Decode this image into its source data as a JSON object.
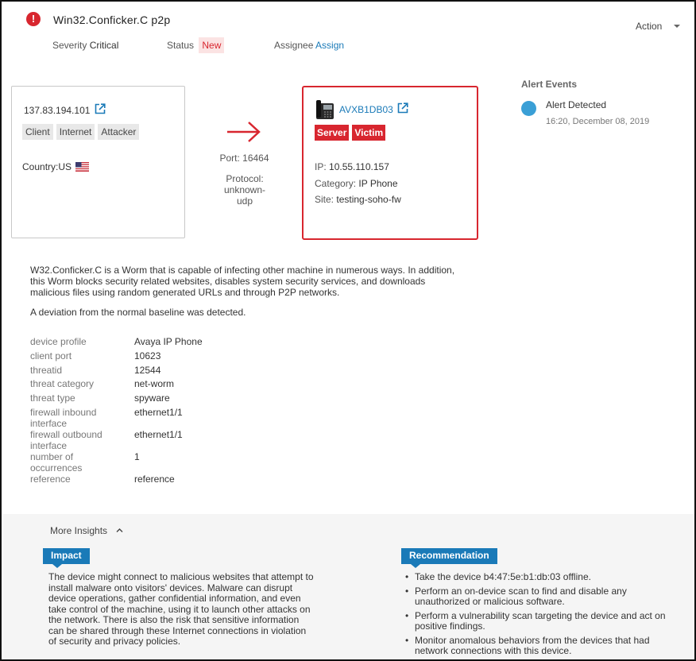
{
  "header": {
    "title": "Win32.Conficker.C p2p",
    "severity_label": "Severity",
    "severity_value": "Critical",
    "status_label": "Status",
    "status_value": "New",
    "assignee_label": "Assignee",
    "assign_link": "Assign",
    "action_label": "Action",
    "alert_icon_glyph": "!"
  },
  "source": {
    "ip": "137.83.194.101",
    "tags": [
      "Client",
      "Internet",
      "Attacker"
    ],
    "country_label": "Country:",
    "country_value": "US"
  },
  "connection": {
    "port_label": "Port:",
    "port_value": "16464",
    "port_text": "Port: 16464",
    "protocol_line1": "Protocol: unknown-",
    "protocol_line2": "udp"
  },
  "destination": {
    "name": "AVXB1DB03",
    "roles": [
      "Server",
      "Victim"
    ],
    "ip_label": "IP:",
    "ip_value": "10.55.110.157",
    "category_label": "Category:",
    "category_value": "IP Phone",
    "site_label": "Site:",
    "site_value": "testing-soho-fw"
  },
  "alert_events": {
    "heading": "Alert Events",
    "items": [
      {
        "name": "Alert Detected",
        "time": "16:20, December 08, 2019"
      }
    ]
  },
  "description": {
    "paragraph": "W32.Conficker.C is a Worm that is capable of infecting other machine in numerous ways. In addition, this Worm blocks security related websites, disables system security services, and downloads malicious files using random generated URLs and through P2P networks.",
    "baseline": "A deviation from the normal baseline was detected."
  },
  "details": [
    {
      "label": "device profile",
      "value": "Avaya IP Phone"
    },
    {
      "label": "client port",
      "value": "10623"
    },
    {
      "label": "threatid",
      "value": "12544"
    },
    {
      "label": "threat category",
      "value": "net-worm"
    },
    {
      "label": "threat type",
      "value": "spyware"
    },
    {
      "label": "firewall inbound interface",
      "value": "ethernet1/1"
    },
    {
      "label": "firewall outbound interface",
      "value": "ethernet1/1"
    },
    {
      "label": "number of occurrences",
      "value": "1"
    },
    {
      "label": "reference",
      "value": "reference"
    }
  ],
  "insights": {
    "toggle_label": "More Insights",
    "impact_title": "Impact",
    "impact_text": "The device might connect to malicious websites that attempt to install malware onto visitors' devices. Malware can disrupt device operations, gather confidential information, and even take control of the machine, using it to launch other attacks on the network. There is also the risk that sensitive information can be shared through these Internet connections in violation of security and privacy policies.",
    "recommendation_title": "Recommendation",
    "recommendations": [
      "Take the device b4:47:5e:b1:db:03 offline.",
      "Perform an on-device scan to find and disable any unauthorized or malicious software.",
      "Perform a vulnerability scan targeting the device and act on positive findings.",
      "Monitor anomalous behaviors from the devices that had network connections with this device."
    ]
  },
  "colors": {
    "critical_red": "#d8262f",
    "link_blue": "#1a7ab8",
    "event_dot": "#3a9fd6",
    "insights_bg": "#f5f5f5"
  }
}
